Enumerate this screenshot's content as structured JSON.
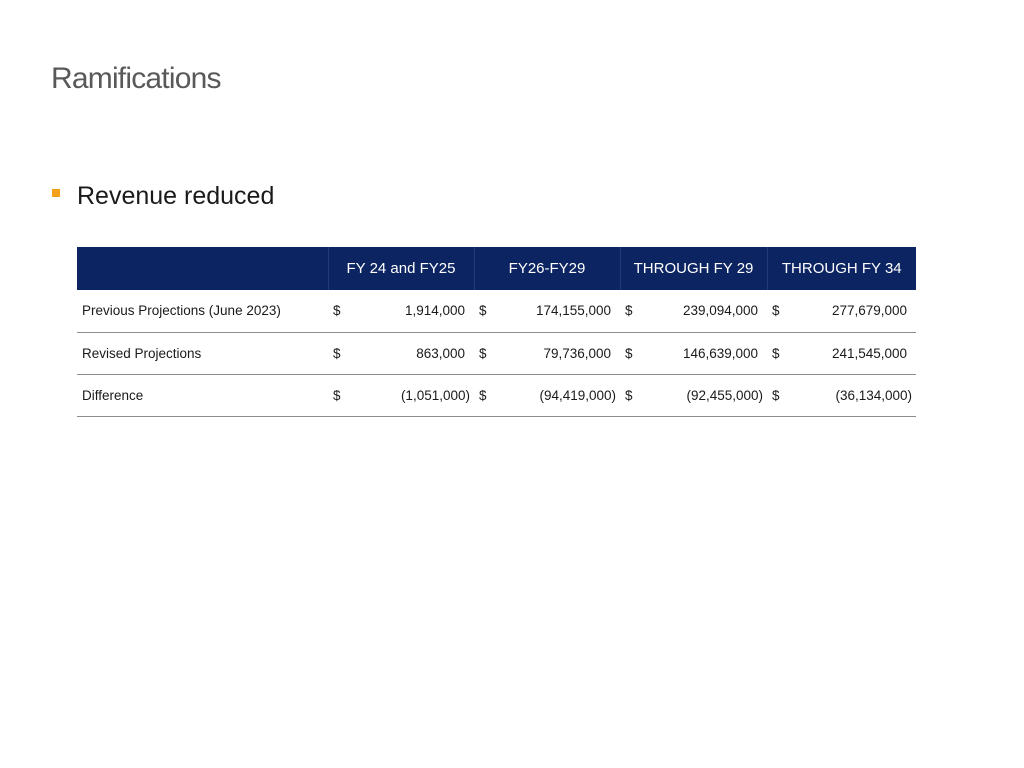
{
  "slide": {
    "title": "Ramifications"
  },
  "bullet": {
    "text": "Revenue reduced",
    "marker_color": "#f5a01a"
  },
  "table": {
    "header_color": "#0c2461",
    "headers": [
      "",
      "FY 24 and FY25",
      "FY26-FY29",
      "THROUGH FY 29",
      "THROUGH FY 34"
    ],
    "currency_symbol": "$",
    "rows": [
      {
        "label": "Previous Projections (June 2023)",
        "values": [
          "1,914,000",
          "174,155,000",
          "239,094,000",
          "277,679,000"
        ]
      },
      {
        "label": "Revised Projections",
        "values": [
          "863,000",
          "79,736,000",
          "146,639,000",
          "241,545,000"
        ]
      },
      {
        "label": "Difference",
        "values": [
          "(1,051,000)",
          "(94,419,000)",
          "(92,455,000)",
          "(36,134,000)"
        ]
      }
    ]
  }
}
